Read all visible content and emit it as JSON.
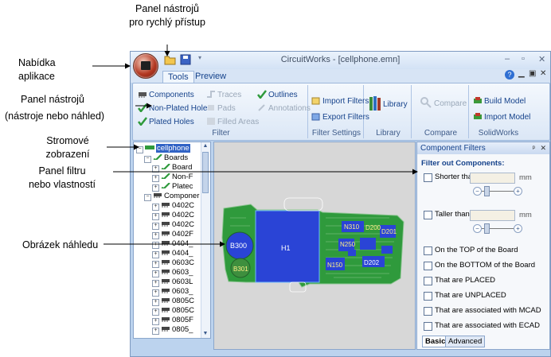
{
  "callouts": {
    "qat": [
      "Panel nástrojů",
      "pro rychlý přístup"
    ],
    "app_menu": [
      "Nabídka",
      "aplikace"
    ],
    "ribbon": [
      "Panel nástrojů",
      "(nástroje nebo náhled)"
    ],
    "tree": [
      "Stromové",
      "zobrazení"
    ],
    "filter": [
      "Panel filtru",
      "nebo vlastností"
    ],
    "preview": "Obrázek náhledu"
  },
  "window": {
    "title": "CircuitWorks - [cellphone.emn]",
    "controls": [
      "–",
      "▫",
      "✕"
    ],
    "tabs": [
      "Tools",
      "Preview"
    ],
    "active_tab": "Tools"
  },
  "ribbon": {
    "filter": {
      "label": "Filter",
      "items": [
        "Components",
        "Non-Plated Holes",
        "Plated Holes",
        "Traces",
        "Pads",
        "Filled Areas",
        "Outlines",
        "Annotations"
      ]
    },
    "filter_settings": {
      "label": "Filter Settings",
      "items": [
        "Import Filters",
        "Export Filters"
      ]
    },
    "library": {
      "label": "Library",
      "button": "Library"
    },
    "compare": {
      "label": "Compare",
      "button": "Compare"
    },
    "solidworks": {
      "label": "SolidWorks",
      "items": [
        "Build Model",
        "Import Model"
      ]
    }
  },
  "tree": {
    "root": "cellphone",
    "rows": [
      "Boards",
      "Board",
      "Non-F",
      "Platec",
      "Componer",
      "0402C",
      "0402C",
      "0402C",
      "0402F",
      "0404_",
      "0404_",
      "0603C",
      "0603_",
      "0603L",
      "0603_",
      "0805C",
      "0805C",
      "0805F",
      "0805_"
    ]
  },
  "preview": {
    "labels": [
      "H1",
      "B300",
      "B301",
      "N310",
      "D200",
      "D201",
      "N250",
      "N150",
      "D202"
    ]
  },
  "filter_pane": {
    "title": "Component Filters",
    "heading": "Filter out Components:",
    "shorter": "Shorter than:",
    "taller": "Taller than:",
    "unit": "mm",
    "options": [
      "On the TOP of the Board",
      "On the BOTTOM of the Board",
      "That are PLACED",
      "That are UNPLACED",
      "That are associated with MCAD",
      "That are associated with ECAD"
    ],
    "tabs": [
      "Basic",
      "Advanced"
    ]
  },
  "colors": {
    "window_bg": "#bcd3ee",
    "board_green": "#2f9a3c",
    "component_blue": "#2a44d6",
    "accent_text": "#15428b"
  }
}
